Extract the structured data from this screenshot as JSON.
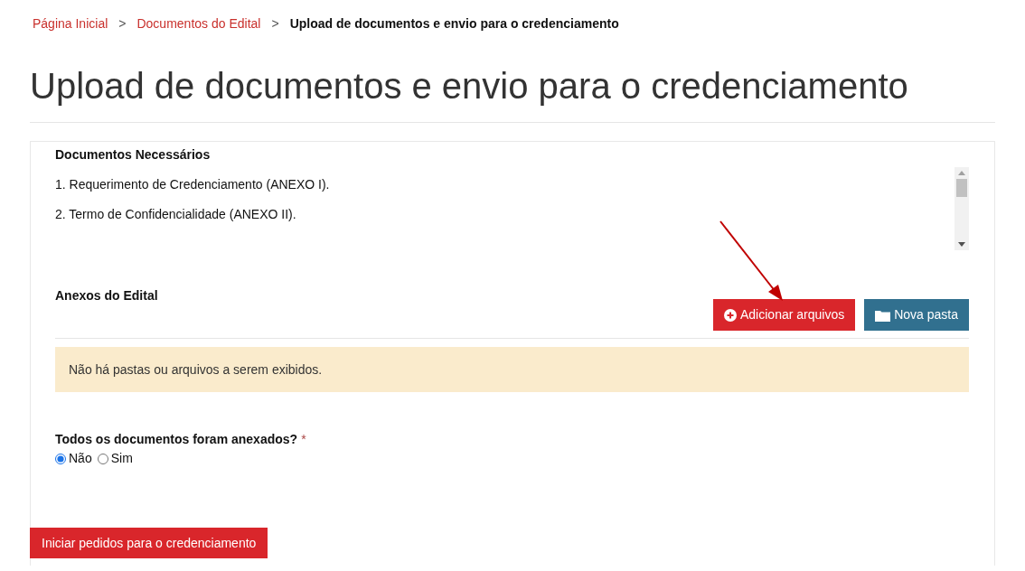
{
  "breadcrumb": [
    {
      "label": "Página Inicial",
      "kind": "link"
    },
    {
      "label": "Documentos do Edital",
      "kind": "link"
    },
    {
      "label": "Upload de documentos e envio para o credenciamento",
      "kind": "current"
    }
  ],
  "breadcrumb_separator": ">",
  "title": "Upload de documentos e envio para o credenciamento",
  "required_documents": {
    "heading": "Documentos Necessários",
    "items": [
      "1. Requerimento de Credenciamento (ANEXO I).",
      "2. Termo de Confidencialidade (ANEXO II)."
    ]
  },
  "attachments": {
    "heading": "Anexos do Edital",
    "buttons": [
      {
        "label": "Adicionar arquivos",
        "kind": "add"
      },
      {
        "label": "Nova pasta",
        "kind": "folder"
      }
    ],
    "empty_message": "Não há pastas ou arquivos a serem exibidos."
  },
  "question": {
    "label": "Todos os documentos foram anexados?",
    "required_mark": "*",
    "options": [
      {
        "label": "Não",
        "selected": true
      },
      {
        "label": "Sim",
        "selected": false
      }
    ]
  },
  "submit_button": "Iniciar pedidos para o credenciamento"
}
